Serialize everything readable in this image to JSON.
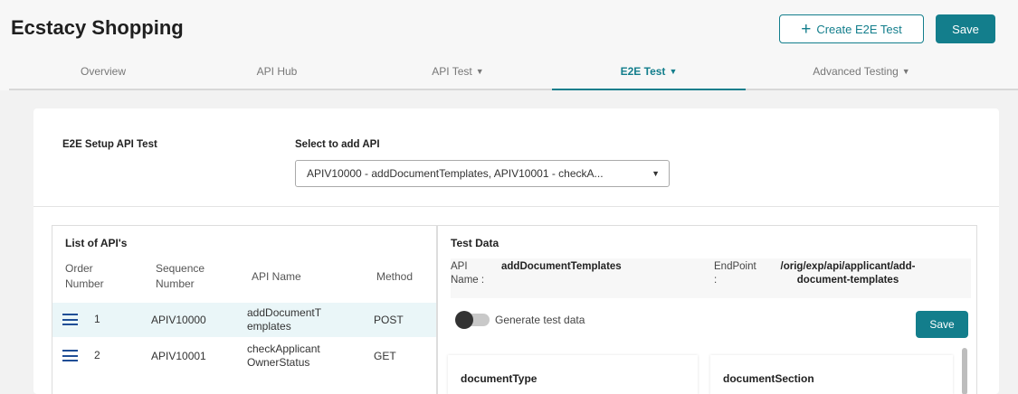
{
  "header": {
    "title": "Ecstacy Shopping",
    "create_label": "Create E2E Test",
    "save_label": "Save"
  },
  "tabs": [
    {
      "label": "Overview"
    },
    {
      "label": "API Hub"
    },
    {
      "label": "API Test"
    },
    {
      "label": "E2E Test"
    },
    {
      "label": "Advanced Testing"
    }
  ],
  "setup": {
    "label": "E2E Setup API Test",
    "select_label": "Select to add API",
    "select_value": "APIV10000 - addDocumentTemplates, APIV10001 - checkA..."
  },
  "api_list": {
    "title": "List of API's",
    "headers": {
      "order": "Order Number",
      "sequence": "Sequence Number",
      "name": "API Name",
      "method": "Method"
    },
    "rows": [
      {
        "order": "1",
        "sequence": "APIV10000",
        "name": "addDocumentTemplates",
        "method": "POST"
      },
      {
        "order": "2",
        "sequence": "APIV10001",
        "name": "checkApplicantOwnerStatus",
        "method": "GET"
      }
    ]
  },
  "test_data": {
    "title": "Test Data",
    "api_name_label": "API Name :",
    "api_name": "addDocumentTemplates",
    "endpoint_label": "EndPoint :",
    "endpoint": "/orig/exp/api/applicant/add-document-templates",
    "toggle_label": "Generate test data",
    "toggle_on": false,
    "save_label": "Save",
    "fields": [
      "documentType",
      "documentSection"
    ]
  },
  "colors": {
    "accent": "#137e8c",
    "drag_icon": "#1f4e96"
  }
}
